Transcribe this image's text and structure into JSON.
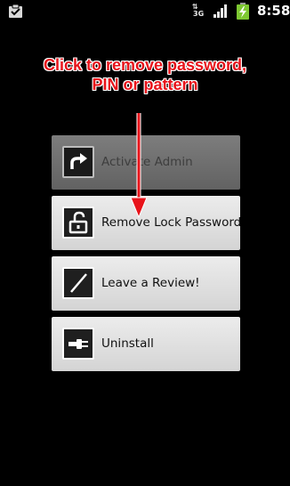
{
  "status_bar": {
    "network": "3G",
    "time": "8:58",
    "icons": [
      "notification-clipboard-icon",
      "data-transfer-icon",
      "signal-icon",
      "battery-charging-icon"
    ]
  },
  "annotation": {
    "line1": "Click to remove password,",
    "line2": "PIN or pattern",
    "color": "#e8131a"
  },
  "buttons": [
    {
      "label": "Activate Admin",
      "icon": "activate-arrow-icon",
      "enabled": false
    },
    {
      "label": "Remove Lock Password",
      "icon": "unlock-padlock-icon",
      "enabled": true
    },
    {
      "label": "Leave a Review!",
      "icon": "pen-slash-icon",
      "enabled": true
    },
    {
      "label": "Uninstall",
      "icon": "unplug-icon",
      "enabled": true
    }
  ]
}
